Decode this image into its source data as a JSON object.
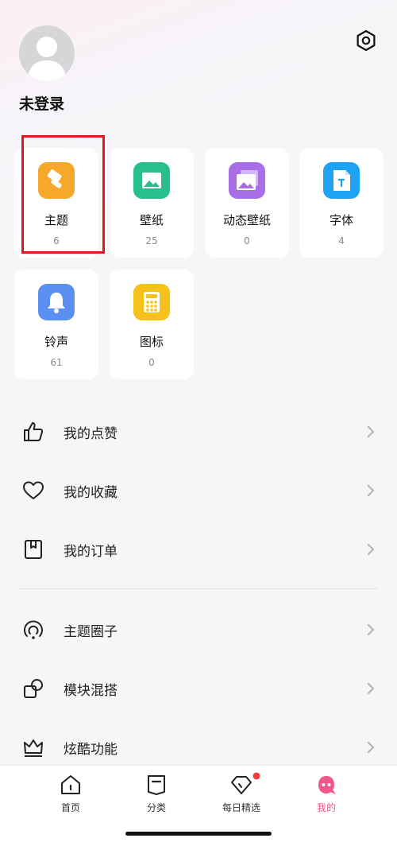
{
  "profile": {
    "username": "未登录"
  },
  "resources": [
    {
      "name": "主题",
      "count": "6",
      "icon": "theme-brush-icon",
      "color": "#f6a82b"
    },
    {
      "name": "壁纸",
      "count": "25",
      "icon": "wallpaper-icon",
      "color": "#27c08a"
    },
    {
      "name": "动态壁纸",
      "count": "0",
      "icon": "live-wallpaper-icon",
      "color": "#a86ee8"
    },
    {
      "name": "字体",
      "count": "4",
      "icon": "font-icon",
      "color": "#1ea3f2"
    },
    {
      "name": "铃声",
      "count": "61",
      "icon": "bell-icon",
      "color": "#5b8ff2"
    },
    {
      "name": "图标",
      "count": "0",
      "icon": "icon-pack-icon",
      "color": "#f5c21b"
    }
  ],
  "menu": [
    {
      "label": "我的点赞",
      "icon": "thumbs-up-icon"
    },
    {
      "label": "我的收藏",
      "icon": "heart-icon"
    },
    {
      "label": "我的订单",
      "icon": "order-icon"
    },
    {
      "label": "主题圈子",
      "icon": "circle-community-icon"
    },
    {
      "label": "模块混搭",
      "icon": "module-mix-icon"
    },
    {
      "label": "炫酷功能",
      "icon": "crown-icon"
    }
  ],
  "tabs": [
    {
      "label": "首页",
      "icon": "home-icon",
      "active": false
    },
    {
      "label": "分类",
      "icon": "category-icon",
      "active": false
    },
    {
      "label": "每日精选",
      "icon": "daily-pick-icon",
      "active": false,
      "badge": true
    },
    {
      "label": "我的",
      "icon": "mine-icon",
      "active": true
    }
  ],
  "colors": {
    "accent": "#f0588d",
    "highlight": "#e8141b",
    "badge": "#f23b3b"
  }
}
